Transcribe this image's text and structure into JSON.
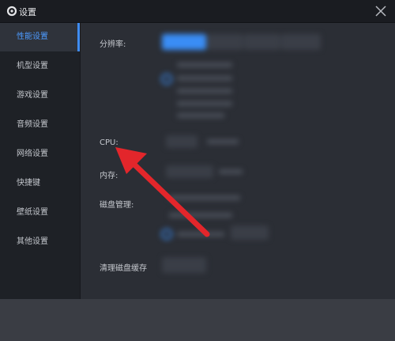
{
  "window": {
    "title": "设置"
  },
  "sidebar": {
    "items": [
      {
        "label": "性能设置",
        "active": true
      },
      {
        "label": "机型设置"
      },
      {
        "label": "游戏设置"
      },
      {
        "label": "音频设置"
      },
      {
        "label": "网络设置"
      },
      {
        "label": "快捷键"
      },
      {
        "label": "壁纸设置"
      },
      {
        "label": "其他设置"
      }
    ]
  },
  "settings": {
    "resolution_label": "分辨率:",
    "cpu_label": "CPU:",
    "memory_label": "内存:",
    "disk_label": "磁盘管理:",
    "clear_cache_label": "清理磁盘缓存"
  },
  "colors": {
    "accent": "#3a8df5",
    "annotation_arrow": "#e3262b"
  },
  "icons": {
    "title": "gear-icon",
    "close": "close-icon"
  }
}
